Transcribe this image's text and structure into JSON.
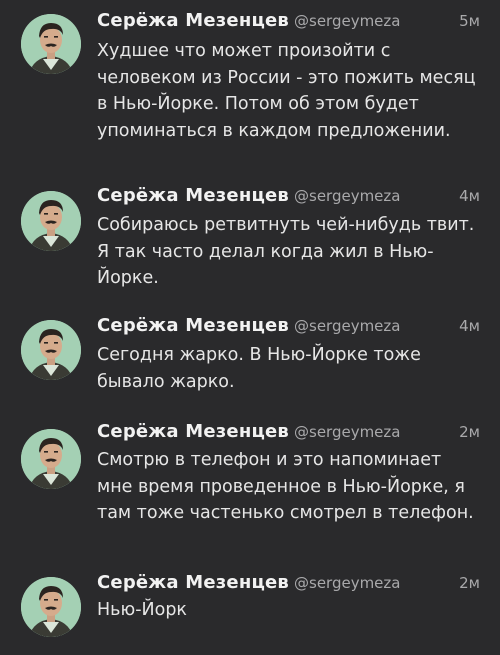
{
  "tweets": [
    {
      "name": "Серёжа Мезенцев",
      "handle": "@sergeymeza",
      "time": "5м",
      "text": "Худшее что может произойти с человеком из России - это пожить месяц в Нью-Йорке. Потом об этом будет упоминаться в каждом предложении."
    },
    {
      "name": "Серёжа Мезенцев",
      "handle": "@sergeymeza",
      "time": "4м",
      "text": "Собираюсь ретвитнуть чей-нибудь твит. Я так часто делал когда жил в Нью-Йорке."
    },
    {
      "name": "Серёжа Мезенцев",
      "handle": "@sergeymeza",
      "time": "4м",
      "text": "Сегодня жарко. В Нью-Йорке тоже бывало жарко."
    },
    {
      "name": "Серёжа Мезенцев",
      "handle": "@sergeymeza",
      "time": "2м",
      "text": "Смотрю в телефон и это напоминает мне время проведенное в Нью-Йорке, я там тоже частенько смотрел в телефон."
    },
    {
      "name": "Серёжа Мезенцев",
      "handle": "@sergeymeza",
      "time": "2м",
      "text": "Нью-Йорк"
    }
  ],
  "colors": {
    "background": "#2a2a2c",
    "name": "#f2f2f2",
    "meta": "#a9a9ab",
    "text": "#e6e6e6",
    "avatar_bg": "#9fcab0"
  },
  "icons": {
    "avatar": "user-avatar-photo"
  }
}
